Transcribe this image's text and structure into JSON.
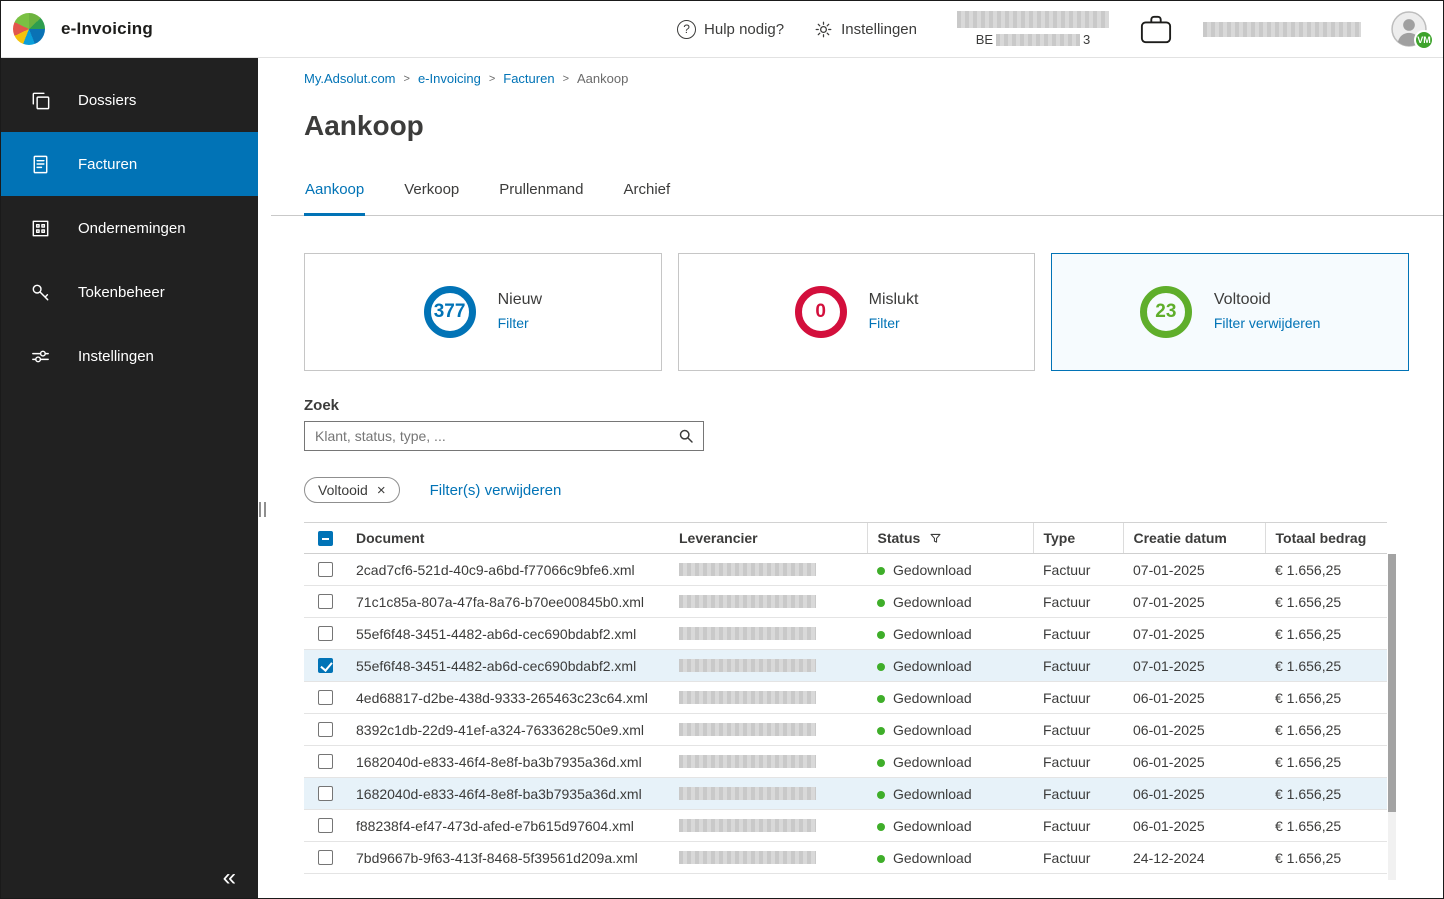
{
  "app": {
    "title": "e-Invoicing",
    "help_icon": "?",
    "help_label": "Hulp nodig?",
    "settings_label": "Instellingen",
    "vat_country": "BE",
    "vat_last_digit": "3",
    "avatar_badge": "VM"
  },
  "colors": {
    "accent_blue": "#0173b6",
    "danger_red": "#d30f3c",
    "success_green": "#5fae2b",
    "status_dot_green": "#3fae2a",
    "sidebar_bg": "#212121",
    "row_highlight": "#e7f2f9"
  },
  "sidebar": {
    "items": [
      {
        "id": "dossiers",
        "label": "Dossiers",
        "icon": "dossiers-icon",
        "active": false
      },
      {
        "id": "facturen",
        "label": "Facturen",
        "icon": "facturen-icon",
        "active": true
      },
      {
        "id": "ondernemingen",
        "label": "Ondernemingen",
        "icon": "ondernemingen-icon",
        "active": false
      },
      {
        "id": "tokenbeheer",
        "label": "Tokenbeheer",
        "icon": "tokenbeheer-icon",
        "active": false
      },
      {
        "id": "instellingen",
        "label": "Instellingen",
        "icon": "instellingen-icon",
        "active": false
      }
    ],
    "collapse": "«"
  },
  "breadcrumb": {
    "separator": ">",
    "items": [
      "My.Adsolut.com",
      "e-Invoicing",
      "Facturen",
      "Aankoop"
    ]
  },
  "page": {
    "title": "Aankoop"
  },
  "tabs": [
    {
      "id": "aankoop",
      "label": "Aankoop",
      "active": true
    },
    {
      "id": "verkoop",
      "label": "Verkoop",
      "active": false
    },
    {
      "id": "prullenmand",
      "label": "Prullenmand",
      "active": false
    },
    {
      "id": "archief",
      "label": "Archief",
      "active": false
    }
  ],
  "stat_cards": [
    {
      "id": "nieuw",
      "count": "377",
      "label": "Nieuw",
      "action": "Filter",
      "color": "#0173b6",
      "selected": false
    },
    {
      "id": "mislukt",
      "count": "0",
      "label": "Mislukt",
      "action": "Filter",
      "color": "#d30f3c",
      "selected": false
    },
    {
      "id": "voltooid",
      "count": "23",
      "label": "Voltooid",
      "action": "Filter verwijderen",
      "color": "#5fae2b",
      "selected": true
    }
  ],
  "search": {
    "label": "Zoek",
    "placeholder": "Klant, status, type, ...",
    "value": ""
  },
  "filters": {
    "chip": "Voltooid",
    "chip_close": "×",
    "clear_link": "Filter(s) verwijderen"
  },
  "table": {
    "columns": [
      "Document",
      "Leverancier",
      "Status",
      "Type",
      "Creatie datum",
      "Totaal bedrag"
    ],
    "rows": [
      {
        "document": "2cad7cf6-521d-40c9-a6bd-f77066c9bfe6.xml",
        "supplier_redacted": true,
        "status": "Gedownload",
        "type": "Factuur",
        "created": "07-01-2025",
        "amount": "€ 1.656,25",
        "checked": false,
        "highlighted": false
      },
      {
        "document": "71c1c85a-807a-47fa-8a76-b70ee00845b0.xml",
        "supplier_redacted": true,
        "status": "Gedownload",
        "type": "Factuur",
        "created": "07-01-2025",
        "amount": "€ 1.656,25",
        "checked": false,
        "highlighted": false
      },
      {
        "document": "55ef6f48-3451-4482-ab6d-cec690bdabf2.xml",
        "supplier_redacted": true,
        "status": "Gedownload",
        "type": "Factuur",
        "created": "07-01-2025",
        "amount": "€ 1.656,25",
        "checked": false,
        "highlighted": false
      },
      {
        "document": "55ef6f48-3451-4482-ab6d-cec690bdabf2.xml",
        "supplier_redacted": true,
        "status": "Gedownload",
        "type": "Factuur",
        "created": "07-01-2025",
        "amount": "€ 1.656,25",
        "checked": true,
        "highlighted": true
      },
      {
        "document": "4ed68817-d2be-438d-9333-265463c23c64.xml",
        "supplier_redacted": true,
        "status": "Gedownload",
        "type": "Factuur",
        "created": "06-01-2025",
        "amount": "€ 1.656,25",
        "checked": false,
        "highlighted": false
      },
      {
        "document": "8392c1db-22d9-41ef-a324-7633628c50e9.xml",
        "supplier_redacted": true,
        "status": "Gedownload",
        "type": "Factuur",
        "created": "06-01-2025",
        "amount": "€ 1.656,25",
        "checked": false,
        "highlighted": false
      },
      {
        "document": "1682040d-e833-46f4-8e8f-ba3b7935a36d.xml",
        "supplier_redacted": true,
        "status": "Gedownload",
        "type": "Factuur",
        "created": "06-01-2025",
        "amount": "€ 1.656,25",
        "checked": false,
        "highlighted": false
      },
      {
        "document": "1682040d-e833-46f4-8e8f-ba3b7935a36d.xml",
        "supplier_redacted": true,
        "status": "Gedownload",
        "type": "Factuur",
        "created": "06-01-2025",
        "amount": "€ 1.656,25",
        "checked": false,
        "highlighted": true
      },
      {
        "document": "f88238f4-ef47-473d-afed-e7b615d97604.xml",
        "supplier_redacted": true,
        "status": "Gedownload",
        "type": "Factuur",
        "created": "06-01-2025",
        "amount": "€ 1.656,25",
        "checked": false,
        "highlighted": false
      },
      {
        "document": "7bd9667b-9f63-413f-8468-5f39561d209a.xml",
        "supplier_redacted": true,
        "status": "Gedownload",
        "type": "Factuur",
        "created": "24-12-2024",
        "amount": "€ 1.656,25",
        "checked": false,
        "highlighted": false
      }
    ]
  }
}
